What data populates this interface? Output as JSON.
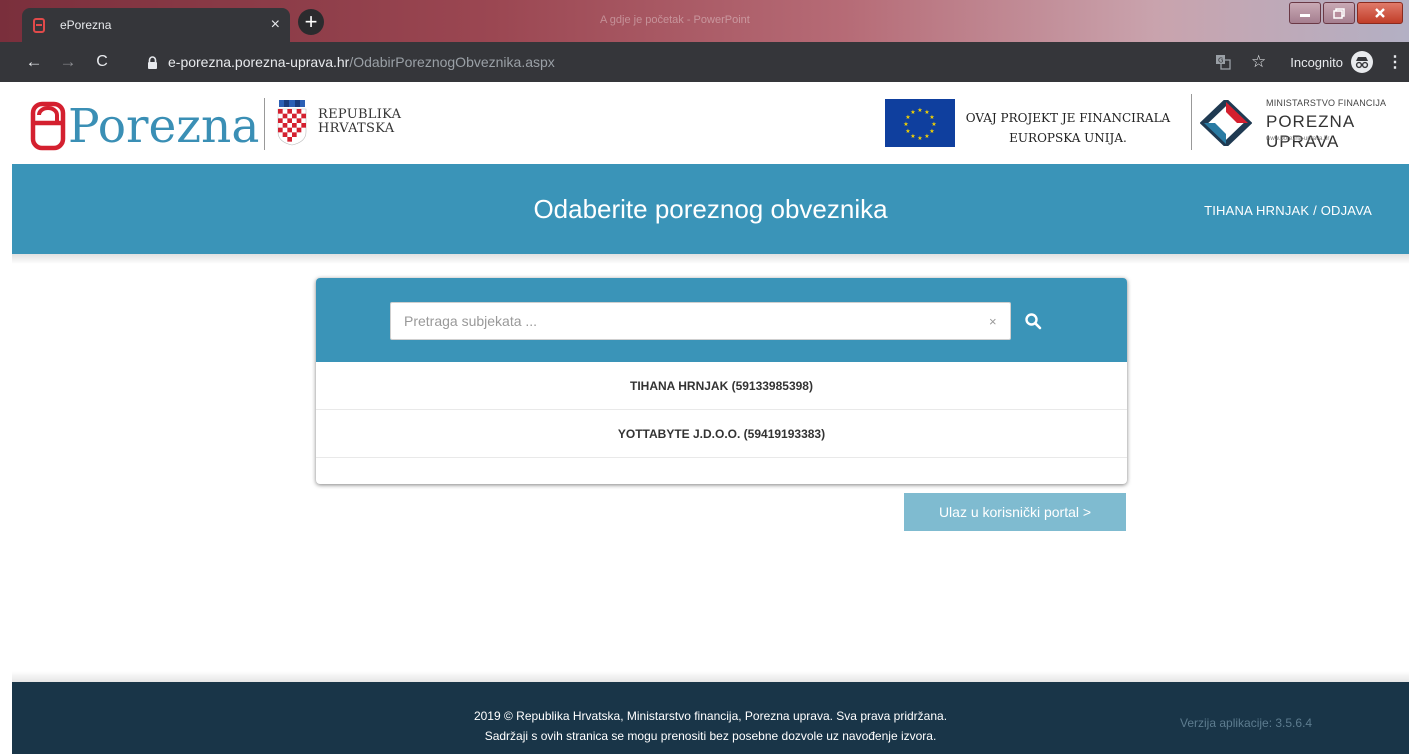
{
  "browser": {
    "tab_title": "ePorezna",
    "tab_close": "×",
    "new_tab": "+",
    "faded_title": "A gdje je početak - PowerPoint",
    "url_host": "e-porezna.porezna-uprava.hr",
    "url_path": "/OdabirPoreznogObveznika.aspx",
    "incognito_label": "Incognito",
    "nav": {
      "back": "←",
      "forward": "→",
      "reload": "C"
    },
    "star": "☆",
    "menu": "⋮"
  },
  "header": {
    "logo_text": "Porezna",
    "republika_line1": "REPUBLIKA",
    "republika_line2": "HRVATSKA",
    "eu_line1": "OVAJ PROJEKT JE FINANCIRALA",
    "eu_line2": "EUROPSKA UNIJA.",
    "mf_small": "MINISTARSTVO FINANCIJA",
    "mf_big": "POREZNA UPRAVA",
    "mf_url": "www.porezna-uprava.hr"
  },
  "band": {
    "title": "Odaberite poreznog obveznika",
    "user_name": "TIHANA HRNJAK",
    "separator": " / ",
    "logout": "ODJAVA"
  },
  "search": {
    "placeholder": "Pretraga subjekata ...",
    "value": "",
    "clear": "×"
  },
  "subjects": [
    {
      "label": "TIHANA HRNJAK (59133985398)"
    },
    {
      "label": "YOTTABYTE J.D.O.O. (59419193383)"
    }
  ],
  "enter_button": "Ulaz u korisnički portal >",
  "footer": {
    "line1": "2019 © Republika Hrvatska, Ministarstvo financija, Porezna uprava. Sva prava pridržana.",
    "line2": "Sadržaji s ovih stranica se mogu prenositi bez posebne dozvole uz navođenje izvora.",
    "version": "Verzija aplikacije: 3.5.6.4"
  },
  "colors": {
    "brand_blue": "#3a94b8",
    "footer_navy": "#193548",
    "button_light_blue": "#7fbbd0",
    "logo_red": "#d4202f"
  },
  "icons": [
    "eporezna-favicon-icon",
    "lock-icon",
    "translate-icon",
    "star-icon",
    "incognito-icon",
    "menu-icon",
    "search-icon",
    "clear-icon",
    "eu-flag-icon",
    "croatian-crest-icon",
    "ministry-logo-icon"
  ]
}
